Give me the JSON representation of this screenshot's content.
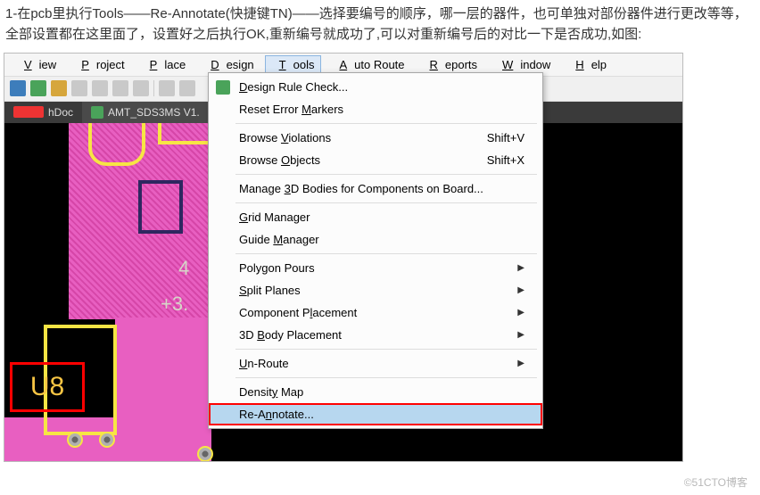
{
  "article": {
    "text": "1-在pcb里执行Tools——Re-Annotate(快捷键TN)——选择要编号的顺序，哪一层的器件，也可单独对部份器件进行更改等等，全部设置都在这里面了，设置好之后执行OK,重新编号就成功了,可以对重新编号后的对比一下是否成功,如图:"
  },
  "menubar": {
    "items": [
      {
        "label": "View",
        "hot": "V"
      },
      {
        "label": "Project",
        "hot": "P"
      },
      {
        "label": "Place",
        "hot": "P"
      },
      {
        "label": "Design",
        "hot": "D"
      },
      {
        "label": "Tools",
        "hot": "T",
        "active": true
      },
      {
        "label": "Auto Route",
        "hot": "A"
      },
      {
        "label": "Reports",
        "hot": "R"
      },
      {
        "label": "Window",
        "hot": "W"
      },
      {
        "label": "Help",
        "hot": "H"
      }
    ]
  },
  "tabs": {
    "doc1_suffix": "hDoc",
    "doc2": "AMT_SDS3MS V1."
  },
  "dropdown": {
    "items": [
      {
        "label": "Design Rule Check...",
        "hot": "D",
        "icon": true
      },
      {
        "label": "Reset Error Markers",
        "hot": "M"
      },
      {
        "sep": true
      },
      {
        "label": "Browse Violations",
        "hot": "V",
        "shortcut": "Shift+V"
      },
      {
        "label": "Browse Objects",
        "hot": "O",
        "shortcut": "Shift+X"
      },
      {
        "sep": true
      },
      {
        "label": "Manage 3D Bodies for Components on Board...",
        "hot": "3"
      },
      {
        "sep": true
      },
      {
        "label": "Grid Manager",
        "hot": "G"
      },
      {
        "label": "Guide Manager",
        "hot": "M"
      },
      {
        "sep": true
      },
      {
        "label": "Polygon Pours",
        "hot": "g",
        "submenu": true
      },
      {
        "label": "Split Planes",
        "hot": "S",
        "submenu": true
      },
      {
        "label": "Component Placement",
        "hot": "l",
        "submenu": true
      },
      {
        "label": "3D Body Placement",
        "hot": "B",
        "submenu": true
      },
      {
        "sep": true
      },
      {
        "label": "Un-Route",
        "hot": "U",
        "submenu": true
      },
      {
        "sep": true
      },
      {
        "label": "Density Map",
        "hot": "y"
      },
      {
        "label": "Re-Annotate...",
        "hot": "N",
        "selected": true,
        "redbox": true
      }
    ]
  },
  "canvas": {
    "u8": "U8",
    "txt4": "4",
    "txt3": "+3."
  },
  "watermark": "©51CTO博客"
}
